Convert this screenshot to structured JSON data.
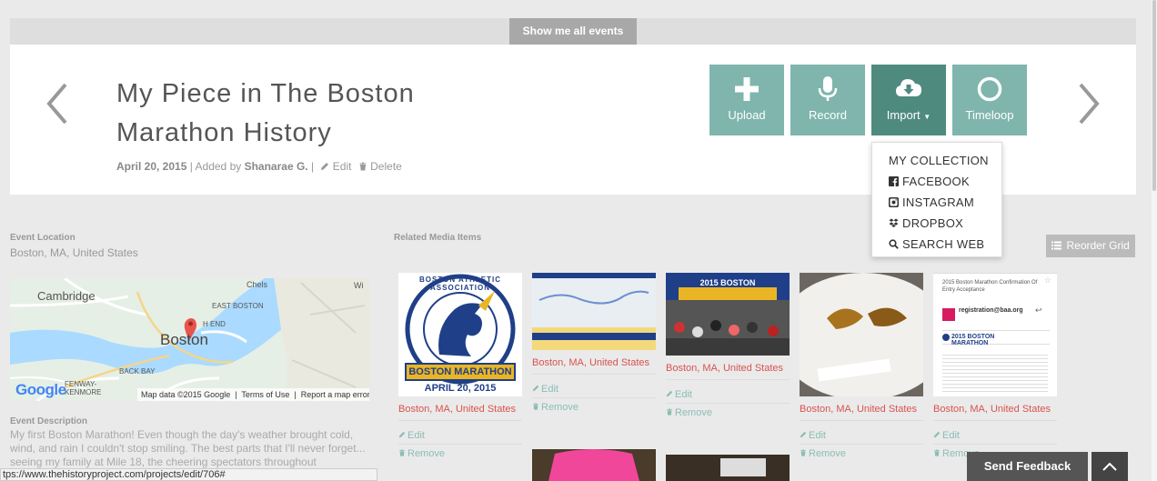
{
  "header": {
    "show_all_label": "Show me all events"
  },
  "event": {
    "title": "My Piece in The Boston Marathon History",
    "date": "April 20, 2015",
    "added_by_prefix": "Added by",
    "author": "Shanarae G.",
    "edit_label": "Edit",
    "delete_label": "Delete"
  },
  "actions": {
    "upload": "Upload",
    "record": "Record",
    "import": "Import",
    "timeloop": "Timeloop"
  },
  "import_menu": [
    "MY COLLECTION",
    "FACEBOOK",
    "INSTAGRAM",
    "DROPBOX",
    "SEARCH WEB"
  ],
  "location": {
    "label": "Event Location",
    "value": "Boston, MA, United States"
  },
  "related": {
    "label": "Related Media Items",
    "reorder_label": "Reorder Grid"
  },
  "map": {
    "labels": {
      "cambridge": "Cambridge",
      "boston": "Boston",
      "east_boston": "EAST BOSTON",
      "north_end": "H END",
      "back_bay": "BACK BAY",
      "fenway": "FENWAY-\nKENMORE",
      "chelsea": "Chels",
      "wi": "Wi"
    },
    "google": "Google",
    "map_data": "Map data ©2015 Google",
    "terms": "Terms of Use",
    "report": "Report a map error"
  },
  "description": {
    "label": "Event Description",
    "text": "My first Boston Marathon! Even though the day's weather brought cold, wind, and rain I couldn't stop smiling. The best parts that I'll never forget... seeing my family at Mile 18, the cheering spectators throughout"
  },
  "media_items": [
    {
      "location": "Boston, MA, United States",
      "edit": "Edit",
      "remove": "Remove",
      "logo_text_top": "BOSTON ATHLETIC ASSOCIATION",
      "logo_text_banner": "BOSTON MARATHON",
      "logo_text_date": "APRIL 20, 2015"
    },
    {
      "location": "Boston, MA, United States",
      "edit": "Edit",
      "remove": "Remove"
    },
    {
      "location": "Boston, MA, United States",
      "edit": "Edit",
      "remove": "Remove",
      "photo_text": "2015 BOSTON"
    },
    {
      "location": "Boston, MA, United States",
      "edit": "Edit",
      "remove": "Remove"
    },
    {
      "location": "Boston, MA, United States",
      "edit": "Edit",
      "remove": "Remove",
      "doc_title": "2015 Boston Marathon Confirmation Of Entry Acceptance",
      "doc_email": "registration@baa.org",
      "doc_brand": "2015 BOSTON MARATHON"
    }
  ],
  "status_url": "tps://www.thehistoryproject.com/projects/edit/706#",
  "feedback_label": "Send Feedback",
  "colors": {
    "teal": "#7fb5ad",
    "teal_dark": "#4f8a7f",
    "location_red": "#d9534f"
  }
}
